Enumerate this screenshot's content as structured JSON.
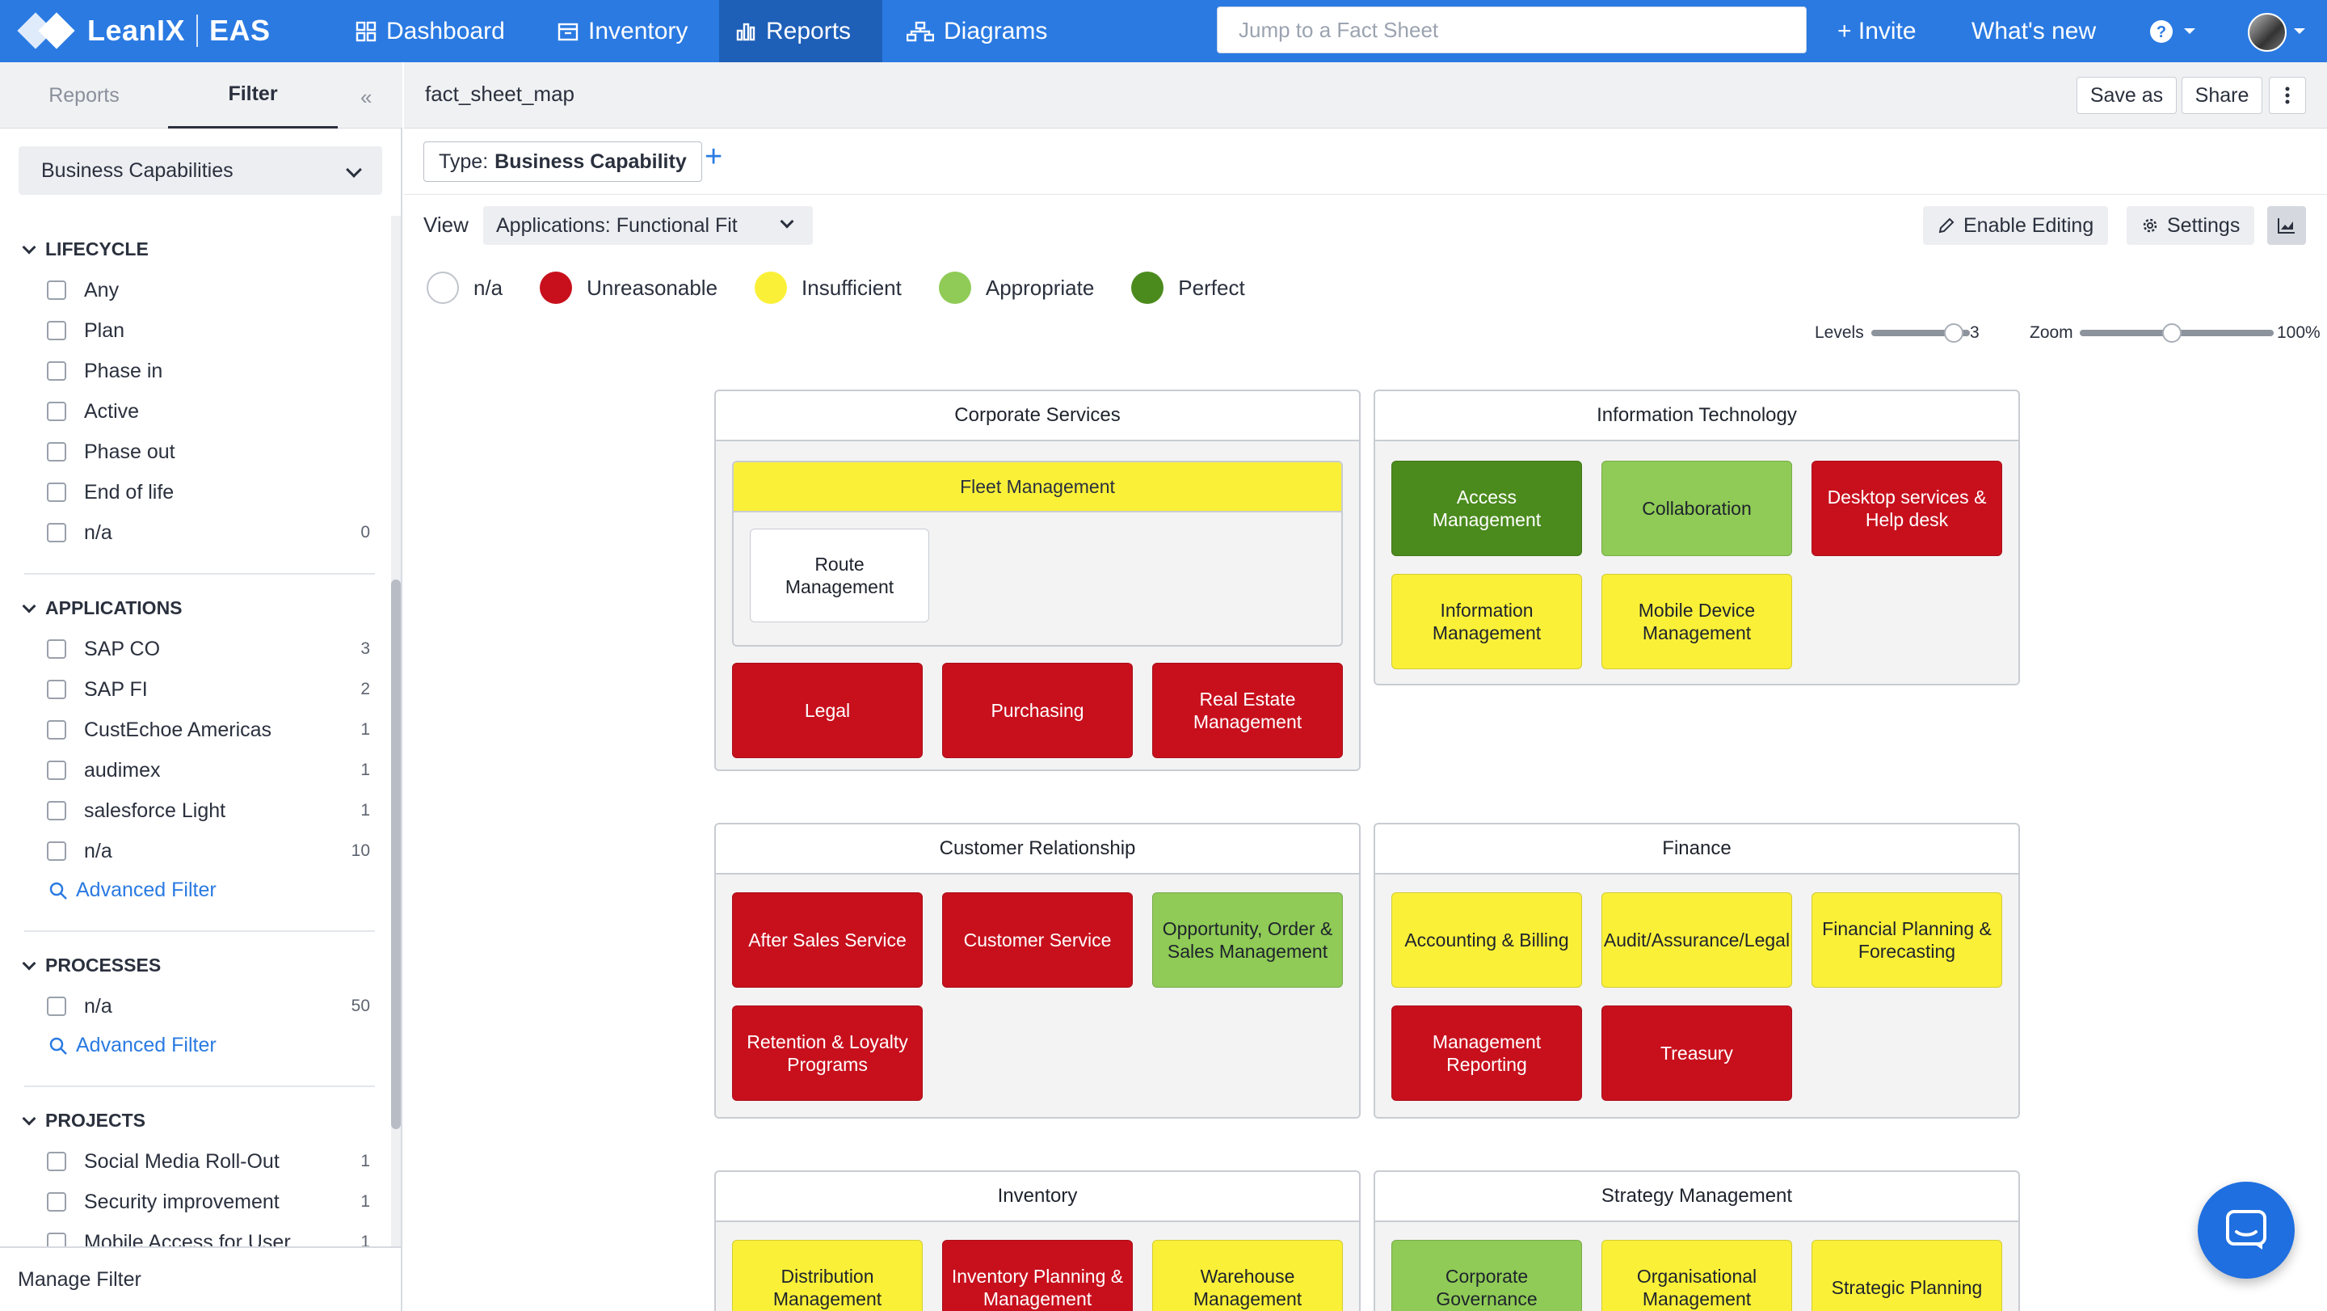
{
  "topbar": {
    "brand": "LeanIX",
    "workspace": "EAS",
    "nav": [
      "Dashboard",
      "Inventory",
      "Reports",
      "Diagrams"
    ],
    "search_placeholder": "Jump to a Fact Sheet",
    "invite": "+ Invite",
    "whats_new": "What's new",
    "help_icon": "help-icon"
  },
  "sidebar": {
    "tabs": [
      "Reports",
      "Filter"
    ],
    "factsheet_type": "Business Capabilities",
    "groups": {
      "lifecycle": {
        "title": "LIFECYCLE",
        "options": [
          {
            "label": "Any",
            "count": ""
          },
          {
            "label": "Plan",
            "count": ""
          },
          {
            "label": "Phase in",
            "count": ""
          },
          {
            "label": "Active",
            "count": ""
          },
          {
            "label": "Phase out",
            "count": ""
          },
          {
            "label": "End of life",
            "count": ""
          },
          {
            "label": "n/a",
            "count": "0"
          }
        ]
      },
      "applications": {
        "title": "APPLICATIONS",
        "options": [
          {
            "label": "SAP CO",
            "count": "3"
          },
          {
            "label": "SAP FI",
            "count": "2"
          },
          {
            "label": "CustEchoe Americas",
            "count": "1"
          },
          {
            "label": "audimex",
            "count": "1"
          },
          {
            "label": "salesforce Light",
            "count": "1"
          },
          {
            "label": "n/a",
            "count": "10"
          }
        ],
        "advanced": "Advanced Filter"
      },
      "processes": {
        "title": "PROCESSES",
        "options": [
          {
            "label": "n/a",
            "count": "50"
          }
        ],
        "advanced": "Advanced Filter"
      },
      "projects": {
        "title": "PROJECTS",
        "options": [
          {
            "label": "Social Media Roll-Out",
            "count": "1"
          },
          {
            "label": "Security improvement",
            "count": "1"
          },
          {
            "label": "Mobile Access for User",
            "count": "1"
          }
        ]
      }
    },
    "manage_filter": "Manage Filter"
  },
  "header": {
    "report_name": "fact_sheet_map",
    "save_as": "Save as",
    "share": "Share",
    "type_prefix": "Type:",
    "type_value": "Business Capability",
    "view_label": "View",
    "view_value": "Applications: Functional Fit",
    "enable_editing": "Enable Editing",
    "settings": "Settings"
  },
  "legend": [
    {
      "label": "n/a",
      "color": "#ffffff"
    },
    {
      "label": "Unreasonable",
      "color": "#c8101d"
    },
    {
      "label": "Insufficient",
      "color": "#faf038"
    },
    {
      "label": "Appropriate",
      "color": "#8fcb56"
    },
    {
      "label": "Perfect",
      "color": "#4b8b1d"
    }
  ],
  "controls": {
    "levels_label": "Levels",
    "levels_value": "3",
    "levels_fraction": 0.92,
    "zoom_label": "Zoom",
    "zoom_value": "100%",
    "zoom_fraction": 0.46
  },
  "map": {
    "corporate_services": {
      "title": "Corporate Services",
      "fleet": {
        "title": "Fleet Management",
        "route": "Route Management"
      },
      "legal": "Legal",
      "purchasing": "Purchasing",
      "real_estate": "Real Estate Management"
    },
    "information_technology": {
      "title": "Information Technology",
      "access": "Access Management",
      "collaboration": "Collaboration",
      "desktop": "Desktop services & Help desk",
      "information": "Information Management",
      "mobile": "Mobile Device Management"
    },
    "customer_relationship": {
      "title": "Customer Relationship",
      "after_sales": "After Sales Service",
      "customer_service": "Customer Service",
      "opportunity": "Opportunity, Order & Sales Management",
      "retention": "Retention & Loyalty Programs"
    },
    "finance": {
      "title": "Finance",
      "accounting": "Accounting & Billing",
      "audit": "Audit/Assurance/Legal",
      "fin_planning": "Financial Planning & Forecasting",
      "mgmt_reporting": "Management Reporting",
      "treasury": "Treasury"
    },
    "inventory": {
      "title": "Inventory",
      "distribution": "Distribution Management",
      "inv_planning": "Inventory Planning & Management",
      "warehouse": "Warehouse Management"
    },
    "strategy": {
      "title": "Strategy Management",
      "governance": "Corporate Governance",
      "org_mgmt": "Organisational Management",
      "strategic_planning": "Strategic Planning"
    }
  }
}
